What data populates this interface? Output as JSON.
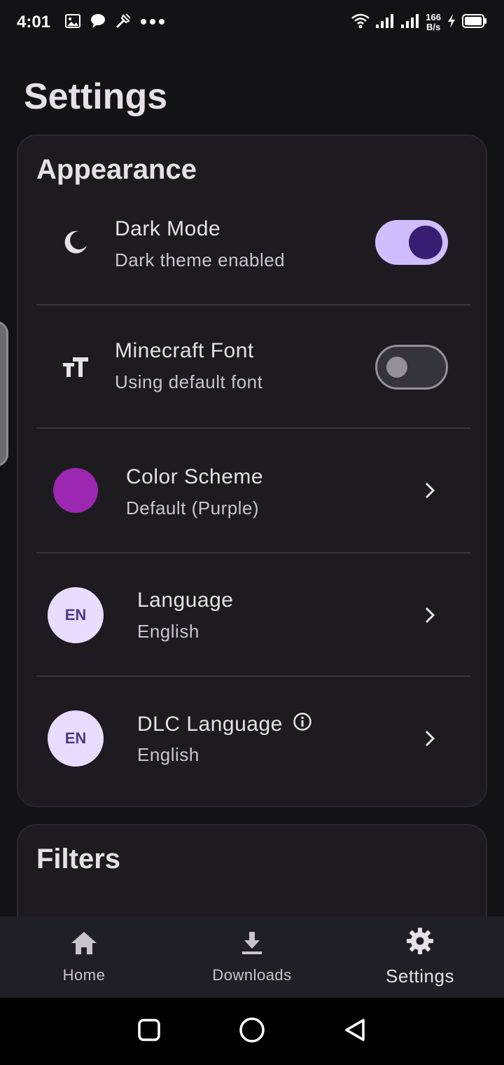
{
  "status_bar": {
    "time": "4:01",
    "speed_value": "166",
    "speed_unit": "B/s"
  },
  "page": {
    "title": "Settings"
  },
  "appearance": {
    "heading": "Appearance",
    "dark_mode": {
      "title": "Dark Mode",
      "subtitle": "Dark theme enabled",
      "enabled": true,
      "icon": "moon-icon"
    },
    "minecraft_font": {
      "title": "Minecraft Font",
      "subtitle": "Using default font",
      "enabled": false,
      "icon": "text-size-icon"
    },
    "color_scheme": {
      "title": "Color Scheme",
      "subtitle": "Default (Purple)",
      "color": "#9c27b0"
    },
    "language": {
      "badge": "EN",
      "title": "Language",
      "subtitle": "English"
    },
    "dlc_language": {
      "badge": "EN",
      "title": "DLC Language",
      "subtitle": "English",
      "icon": "info-icon"
    }
  },
  "filters": {
    "heading": "Filters"
  },
  "bottom_nav": {
    "items": [
      {
        "label": "Home",
        "icon": "home-icon",
        "active": false
      },
      {
        "label": "Downloads",
        "icon": "download-icon",
        "active": false
      },
      {
        "label": "Settings",
        "icon": "gear-icon",
        "active": true
      }
    ]
  },
  "colors": {
    "background": "#131316",
    "card": "#1d1b20",
    "accent": "#cfbdfe",
    "accent_dark": "#381e72"
  }
}
